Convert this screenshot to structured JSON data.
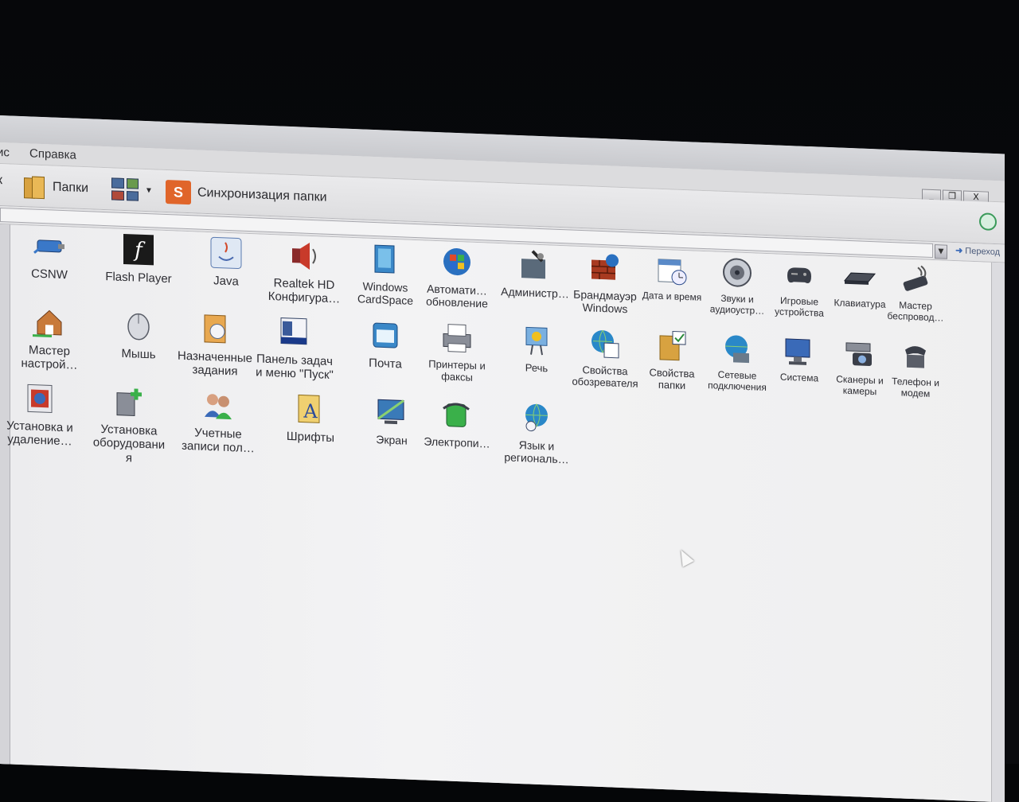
{
  "menu": {
    "items": [
      {
        "label": "ис"
      },
      {
        "label": "Справка"
      }
    ]
  },
  "window_buttons": {
    "minimize": "_",
    "maximize": "❐",
    "close": "X"
  },
  "toolbar": {
    "back_fragment": "к",
    "folders_label": "Папки",
    "sync_label": "Синхронизация папки",
    "sync_icon_letter": "S"
  },
  "addressbar": {
    "go_label": "Переход",
    "dropdown_glyph": "▼",
    "go_arrow": "➜"
  },
  "control_panel": {
    "rows": [
      [
        {
          "label": "CSNW",
          "icon": "network-cable-icon"
        },
        {
          "label": "Flash Player",
          "icon": "flash-player-icon"
        },
        {
          "label": "Java",
          "icon": "java-icon"
        },
        {
          "label": "Realtek HD\nКонфигура…",
          "icon": "speaker-icon"
        },
        {
          "label": "Windows\nCardSpace",
          "icon": "cardspace-icon"
        },
        {
          "label": "Автомати…\nобновление",
          "icon": "windows-update-icon"
        },
        {
          "label": "Администр…",
          "icon": "admin-tools-icon"
        },
        {
          "label": "Брандмауэр\nWindows",
          "icon": "firewall-icon"
        },
        {
          "label": "Дата и время",
          "icon": "calendar-clock-icon"
        },
        {
          "label": "Звуки и\nаудиоустр…",
          "icon": "sound-icon"
        },
        {
          "label": "Игровые\nустройства",
          "icon": "gamepad-icon"
        },
        {
          "label": "Клавиатура",
          "icon": "keyboard-icon"
        },
        {
          "label": "Мастер\nбеспровод…",
          "icon": "wireless-icon"
        }
      ],
      [
        {
          "label": "Мастер\nнастрой…",
          "icon": "home-network-icon"
        },
        {
          "label": "Мышь",
          "icon": "mouse-icon"
        },
        {
          "label": "Назначенные\nзадания",
          "icon": "scheduled-tasks-icon"
        },
        {
          "label": "Панель задач\nи меню \"Пуск\"",
          "icon": "taskbar-icon"
        },
        {
          "label": "Почта",
          "icon": "mail-icon"
        },
        {
          "label": "Принтеры и\nфаксы",
          "icon": "printer-icon"
        },
        {
          "label": "Речь",
          "icon": "speech-icon"
        },
        {
          "label": "Свойства\nобозревателя",
          "icon": "internet-options-icon"
        },
        {
          "label": "Свойства\nпапки",
          "icon": "folder-options-icon"
        },
        {
          "label": "Сетевые\nподключения",
          "icon": "network-connections-icon"
        },
        {
          "label": "Система",
          "icon": "system-icon"
        },
        {
          "label": "Сканеры и\nкамеры",
          "icon": "scanner-camera-icon"
        },
        {
          "label": "Телефон и\nмодем",
          "icon": "phone-modem-icon"
        }
      ],
      [
        {
          "label": "Установка и\nудаление…",
          "icon": "add-remove-programs-icon"
        },
        {
          "label": "Установка\nоборудовани\nя",
          "icon": "add-hardware-icon"
        },
        {
          "label": "Учетные\nзаписи пол…",
          "icon": "user-accounts-icon"
        },
        {
          "label": "Шрифты",
          "icon": "fonts-icon"
        },
        {
          "label": "Экран",
          "icon": "display-icon"
        },
        {
          "label": "Электропи…",
          "icon": "power-options-icon"
        },
        {
          "label": "Язык и\nрегиональ…",
          "icon": "regional-options-icon"
        }
      ]
    ]
  }
}
